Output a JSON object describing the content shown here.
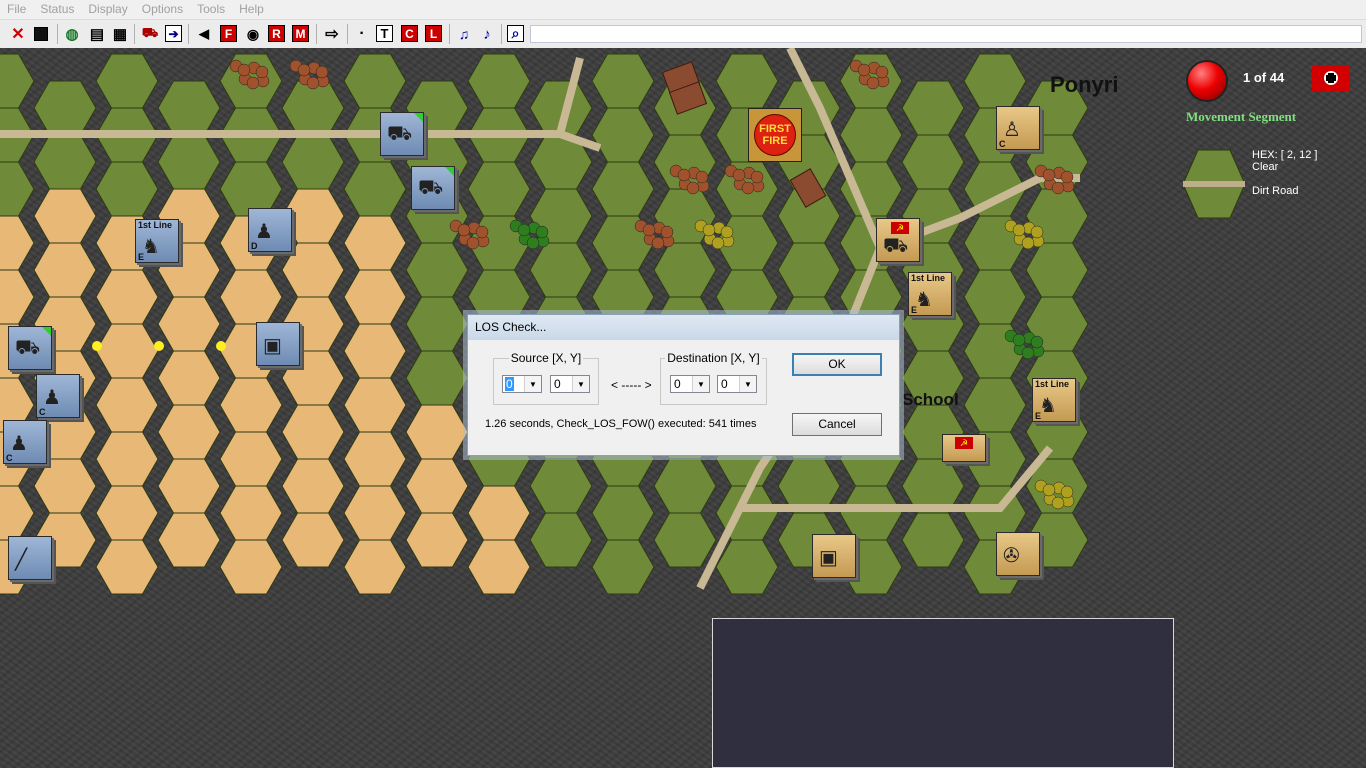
{
  "menu": [
    "File",
    "Status",
    "Display",
    "Options",
    "Tools",
    "Help"
  ],
  "toolbar": {
    "buttons": [
      {
        "name": "close-icon",
        "glyph": "✕",
        "color": "#d00000"
      },
      {
        "name": "save-icon",
        "glyph": "▪",
        "color": "#000000"
      },
      {
        "name": "globe-icon",
        "glyph": "◍",
        "color": "#1a7a2a"
      },
      {
        "name": "window-icon",
        "glyph": "▤",
        "color": "#333333"
      },
      {
        "name": "grid-icon",
        "glyph": "▦",
        "color": "#333333"
      },
      {
        "name": "tank-turn-icon",
        "glyph": "⛟",
        "color": "#aa0000"
      },
      {
        "name": "next-arrow-icon",
        "glyph": "➔",
        "color": "#000080"
      },
      {
        "name": "left-triangle-icon",
        "glyph": "◀",
        "color": "#000000"
      },
      {
        "name": "f-icon",
        "glyph": "F",
        "color": "#ffffff"
      },
      {
        "name": "eye-icon",
        "glyph": "◉",
        "color": "#000000"
      },
      {
        "name": "r-icon",
        "glyph": "R",
        "color": "#ffffff"
      },
      {
        "name": "m-icon",
        "glyph": "M",
        "color": "#ffffff"
      },
      {
        "name": "right-arrow-icon",
        "glyph": "⇨",
        "color": "#000000"
      },
      {
        "name": "dot-icon",
        "glyph": "·",
        "color": "#000000"
      },
      {
        "name": "t-icon",
        "glyph": "T",
        "color": "#000000"
      },
      {
        "name": "c-icon",
        "glyph": "C",
        "color": "#ffffff"
      },
      {
        "name": "l-icon",
        "glyph": "L",
        "color": "#ffffff"
      },
      {
        "name": "sound-fx-icon",
        "glyph": "♫",
        "color": "#0000a0"
      },
      {
        "name": "music-icon",
        "glyph": "♪",
        "color": "#0000a0"
      },
      {
        "name": "zoom-icon",
        "glyph": "⌕",
        "color": "#0000a0"
      }
    ]
  },
  "map": {
    "town_name": "Ponyri",
    "landmark": "School",
    "counter_labels": {
      "first_line": "1st Line"
    },
    "fire_marker": "FIRST FIRE"
  },
  "status": {
    "turn": "1 of 44",
    "phase": "Movement Segment",
    "hex_coord": "HEX: [ 2, 12 ]",
    "terrain": "Clear",
    "road": "Dirt Road"
  },
  "dialog": {
    "title": "LOS Check...",
    "source_label": "Source [X, Y]",
    "destination_label": "Destination [X, Y]",
    "source_x": "0",
    "source_y": "0",
    "dest_x": "0",
    "dest_y": "0",
    "arrow": "< ----- >",
    "status_text": "1.26 seconds, Check_LOS_FOW() executed: 541 times",
    "ok_label": "OK",
    "cancel_label": "Cancel"
  },
  "colors": {
    "grass": "#6f8a38",
    "wheat": "#e8b876",
    "rock": "#3d3d3d",
    "phase_text": "#7fe07f"
  }
}
